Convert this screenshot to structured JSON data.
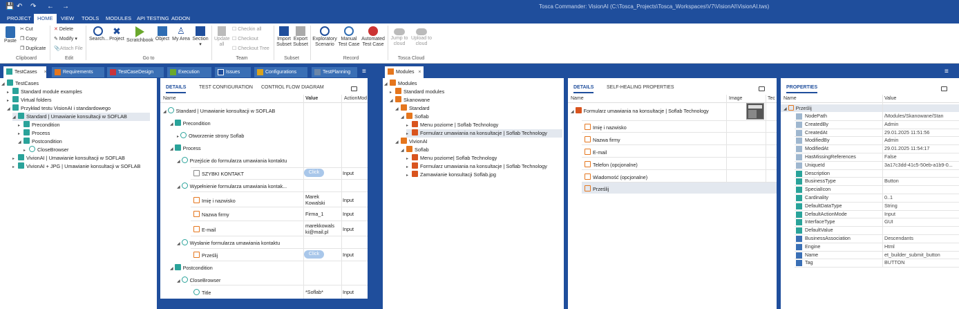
{
  "window_title": "Tosca Commander: VisionAI (C:\\Tosca_Projects\\Tosca_Workspaces\\V7\\VisionAI\\VisionAI.tws)",
  "menu_tabs": [
    "PROJECT",
    "HOME",
    "VIEW",
    "TOOLS",
    "MODULES",
    "API TESTING",
    "ADDON"
  ],
  "ribbon": {
    "paste": "Paste",
    "cut": "Cut",
    "copy": "Copy",
    "duplicate": "Duplicate",
    "clipboard": "Clipboard",
    "delete": "Delete",
    "modify": "Modify",
    "attach_file": "Attach File",
    "edit": "Edit",
    "search": "Search...",
    "project": "Project",
    "scratchbook": "Scratchbook",
    "object": "Object",
    "my_area": "My Area",
    "section": "Section",
    "goto": "Go to",
    "update_all_1": "Update",
    "update_all_2": "all",
    "checkin_all": "Checkin all",
    "checkout": "Checkout",
    "checkout_tree": "Checkout Tree",
    "team": "Team",
    "import_1": "Import",
    "import_2": "Subset",
    "export_1": "Export",
    "export_2": "Subset",
    "subset": "Subset",
    "expl_1": "Exploratory",
    "expl_2": "Scenario",
    "manual_1": "Manual",
    "manual_2": "Test Case",
    "auto_1": "Automated",
    "auto_2": "Test Case",
    "record": "Record",
    "jump_1": "Jump to",
    "jump_2": "cloud",
    "upload_1": "Upload to",
    "upload_2": "cloud",
    "tosca_cloud": "Tosca Cloud"
  },
  "doc_tabs": [
    "TestCases",
    "Requirements",
    "TestCaseDesign",
    "Execution",
    "Issues",
    "Configurations",
    "TestPlanning",
    "Modules"
  ],
  "colors": {
    "brand": "#1f4e9c",
    "testcase": "#2aa39a",
    "module": "#d9541e",
    "click": "#a9c7ea"
  },
  "testcases_tree": [
    "TestCases",
    "Standard module examples",
    "Virtual folders",
    "Przykład testu VisionAI i standardowego",
    "Standard | Umawianie konsultacji w SOFLAB",
    "Precondition",
    "Process",
    "Postcondition",
    "CloseBrowser",
    "VivionAI | Umawianie konsultacji w SOFLAB",
    "VivionAI + JPG | Umawianie konsultacji w SOFLAB"
  ],
  "details": {
    "tabs": [
      "DETAILS",
      "TEST CONFIGURATION",
      "CONTROL FLOW DIAGRAM"
    ],
    "columns": [
      "Name",
      "Value",
      "ActionMod"
    ],
    "rows": [
      {
        "name": "Standard | Umawianie konsultacji w SOFLAB",
        "value": "",
        "action": ""
      },
      {
        "name": "Precondition",
        "value": "",
        "action": ""
      },
      {
        "name": "Otworzenie strony Soflab",
        "value": "",
        "action": ""
      },
      {
        "name": "Process",
        "value": "",
        "action": ""
      },
      {
        "name": "Przejście do formularza umawiania kontaktu",
        "value": "",
        "action": ""
      },
      {
        "name": "SZYBKI KONTAKT",
        "value": "Click",
        "action": "Input"
      },
      {
        "name": "Wypełnienie formularza umawiania kontak...",
        "value": "",
        "action": ""
      },
      {
        "name": "Imię i nazwisko",
        "value_1": "Marek",
        "value_2": "Kowalski",
        "action": "Input"
      },
      {
        "name": "Nazwa firmy",
        "value": "Firma_1",
        "action": "Input"
      },
      {
        "name": "E-mail",
        "value_1": "marekkowals",
        "value_2": "ki@mail.pl",
        "action": "Input"
      },
      {
        "name": "Wysłanie formularza umawiania kontaktu",
        "value": "",
        "action": ""
      },
      {
        "name": "Prześlij",
        "value": "Click",
        "action": "Input"
      },
      {
        "name": "Postcondition",
        "value": "",
        "action": ""
      },
      {
        "name": "CloseBrowser",
        "value": "",
        "action": ""
      },
      {
        "name": "Title",
        "value": "*Soflab*",
        "action": "Input"
      }
    ]
  },
  "modules_tree": [
    "Modules",
    "Standard modules",
    "Skanowane",
    "Standard",
    "Soflab",
    "Menu poziome | Soflab Technology",
    "Formularz umawiania na konsultacje | Soflab Technology",
    "VivionAI",
    "Soflab",
    "Menu poziome| Soflab Technology",
    "Formularz umawiania na konsultacje | Soflab Technology",
    "Zamawianie konsultacji Soflab.jpg"
  ],
  "module_details": {
    "tabs": [
      "DETAILS",
      "SELF-HEALING PROPERTIES"
    ],
    "columns": [
      "Name",
      "Image",
      "Tec"
    ],
    "rows": [
      "Formularz umawiania na konsultacje | Soflab Technology",
      "Imię i nazwisko",
      "Nazwa firmy",
      "E-mail",
      "Telefon (opcjonalne)",
      "Wiadomość (opcjonalne)",
      "Prześlij"
    ]
  },
  "properties": {
    "tab": "PROPERTIES",
    "columns": [
      "Name",
      "Value"
    ],
    "root": "Prześlij",
    "items": [
      {
        "name": "NodePath",
        "value": "/Modules/Skanowane/Stan"
      },
      {
        "name": "CreatedBy",
        "value": "Admin"
      },
      {
        "name": "CreatedAt",
        "value": "29.01.2025 11:51:56"
      },
      {
        "name": "ModifiedBy",
        "value": "Admin"
      },
      {
        "name": "ModifiedAt",
        "value": "29.01.2025 11:54:17"
      },
      {
        "name": "HasMissingReferences",
        "value": "False"
      },
      {
        "name": "UniqueId",
        "value": "3a17c3dd-41c5-50eb-a1b9-0..."
      },
      {
        "name": "Description",
        "value": ""
      },
      {
        "name": "BusinessType",
        "value": "Button"
      },
      {
        "name": "SpecialIcon",
        "value": ""
      },
      {
        "name": "Cardinality",
        "value": "0..1"
      },
      {
        "name": "DefaultDataType",
        "value": "String"
      },
      {
        "name": "DefaultActionMode",
        "value": "Input"
      },
      {
        "name": "InterfaceType",
        "value": "GUI"
      },
      {
        "name": "DefaultValue",
        "value": ""
      },
      {
        "name": "BusinessAssociation",
        "value": "Descendants"
      },
      {
        "name": "Engine",
        "value": "Html"
      },
      {
        "name": "Name",
        "value": "et_builder_submit_button"
      },
      {
        "name": "Tag",
        "value": "BUTTON"
      }
    ]
  }
}
